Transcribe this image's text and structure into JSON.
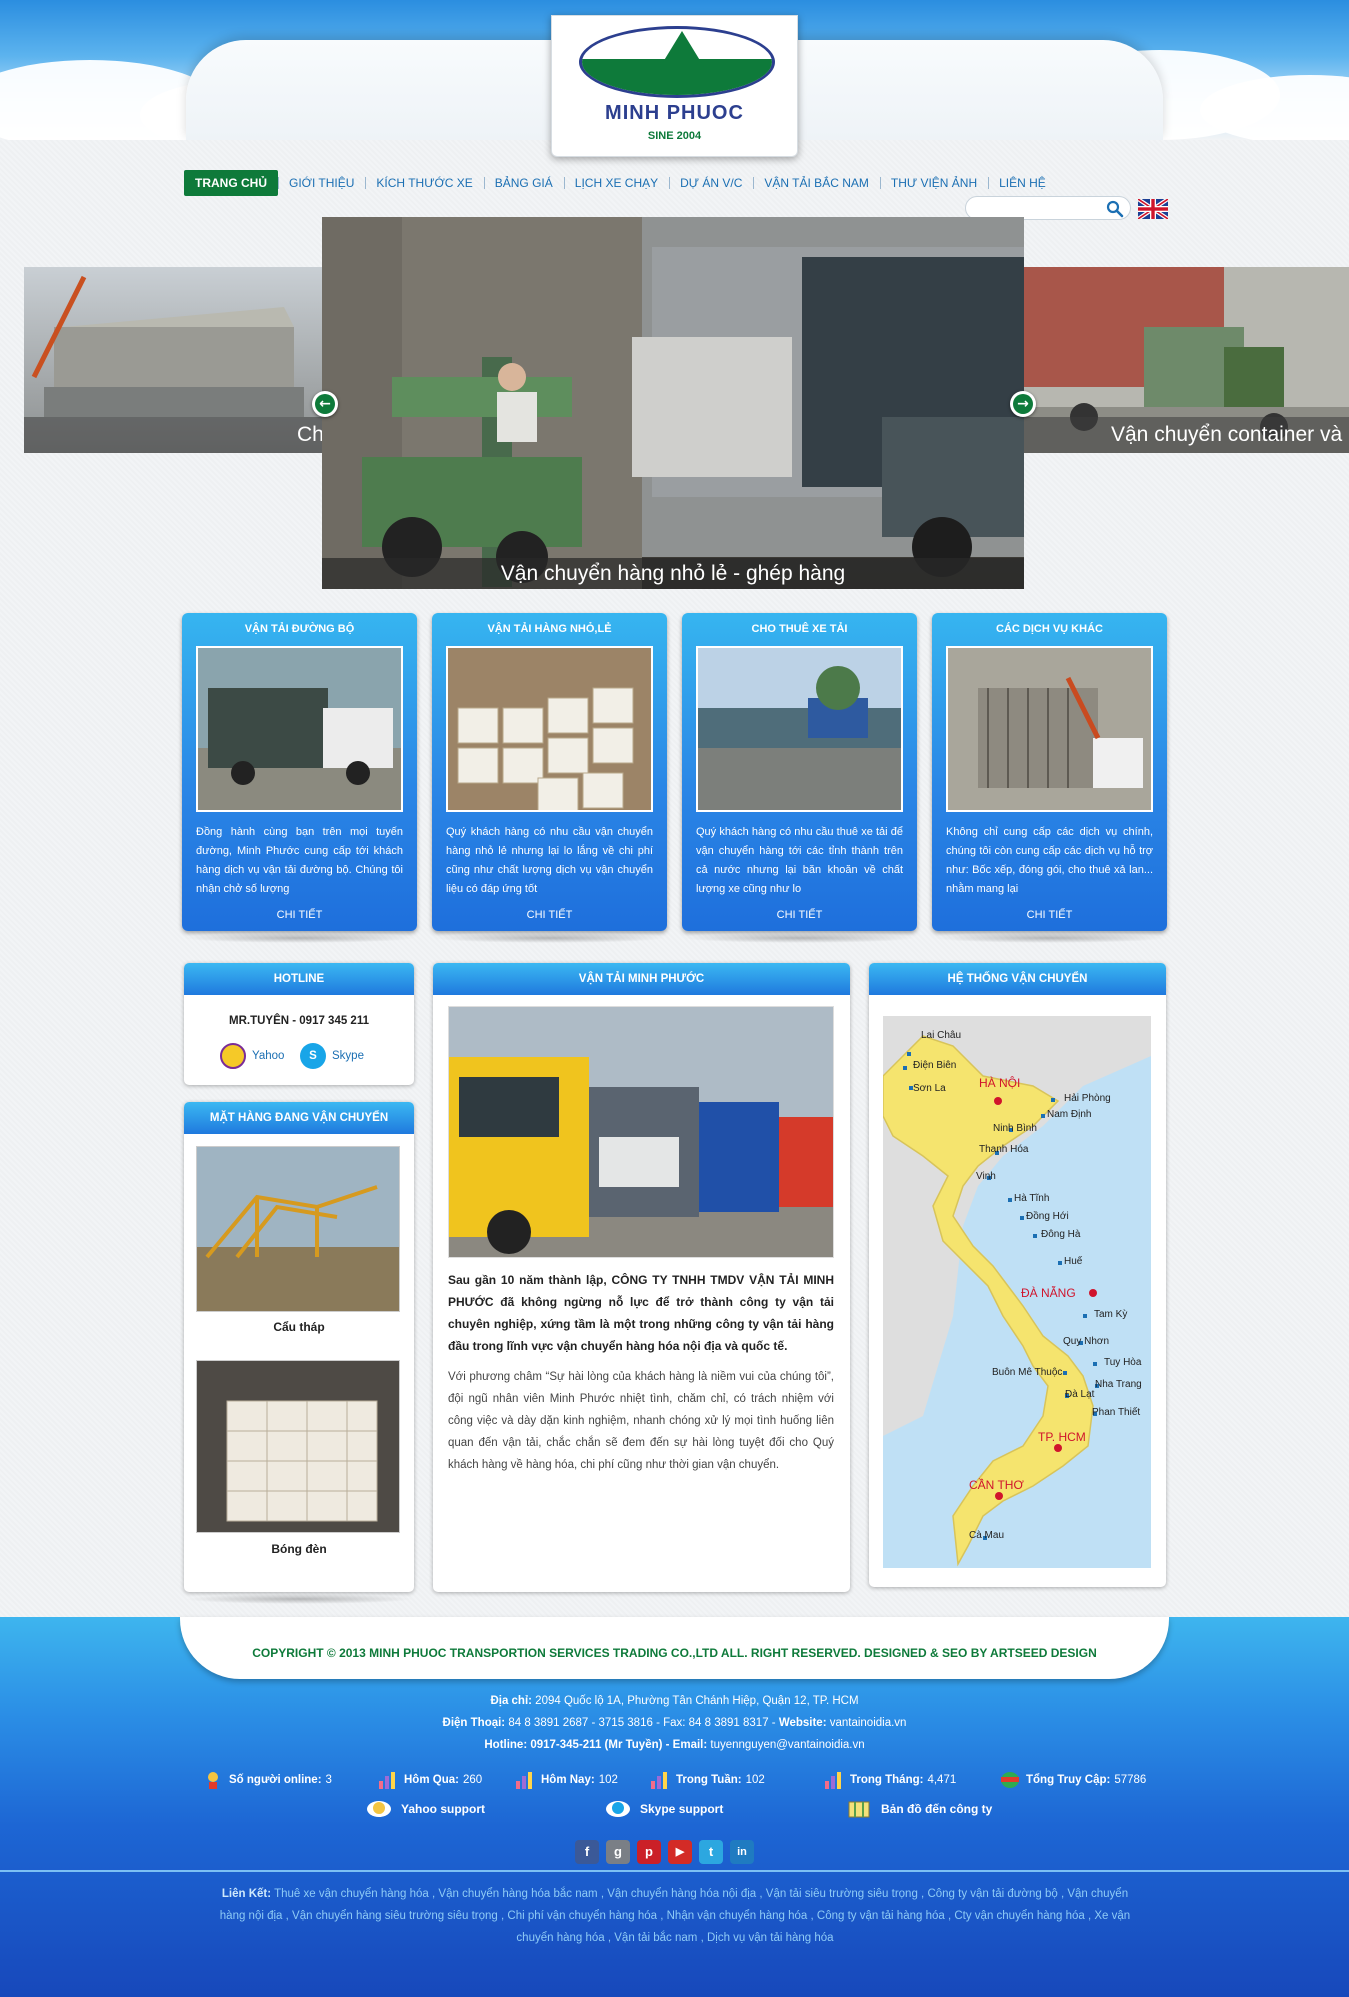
{
  "header": {
    "logo_name": "MINH PHUOC",
    "logo_since": "SINE 2004"
  },
  "nav": {
    "items": [
      {
        "label": "TRANG CHỦ",
        "active": true
      },
      {
        "label": "GIỚI THIỆU"
      },
      {
        "label": "KÍCH THƯỚC XE"
      },
      {
        "label": "BẢNG GIÁ"
      },
      {
        "label": "LỊCH XE CHẠY"
      },
      {
        "label": "DỰ ÁN V/C"
      },
      {
        "label": "VẬN TẢI BẮC NAM"
      },
      {
        "label": "THƯ VIỆN ẢNH"
      },
      {
        "label": "LIÊN HỆ"
      }
    ],
    "search_placeholder": "",
    "flag": "uk-flag-icon"
  },
  "slider": {
    "main_caption": "Vận chuyển hàng nhỏ lẻ - ghép hàng",
    "left_caption": "Ch",
    "right_caption": "Vận chuyển container và",
    "prev_icon": "arrow-left-icon",
    "next_icon": "arrow-right-icon"
  },
  "services": [
    {
      "title": "VẬN TẢI ĐƯỜNG BỘ",
      "text": "Đồng hành cùng bạn trên mọi tuyến đường, Minh Phước cung cấp tới khách hàng dịch vụ vận tải đường bộ. Chúng tôi nhận chở số lượng",
      "more": "CHI TIẾT"
    },
    {
      "title": "VẬN TẢI HÀNG NHỎ,LẺ",
      "text": "Quý khách hàng có nhu cầu vận chuyển hàng nhỏ lẻ nhưng lại lo lắng về chi phí cũng như chất lượng dịch vụ vận chuyển liệu có đáp ứng tốt",
      "more": "CHI TIẾT"
    },
    {
      "title": "CHO THUÊ XE TẢI",
      "text": "Quý khách hàng có nhu cầu thuê xe tải để vận chuyển hàng tới các tỉnh thành trên cả nước nhưng lại băn khoăn về chất lượng xe cũng như lo",
      "more": "CHI TIẾT"
    },
    {
      "title": "CÁC DỊCH VỤ KHÁC",
      "text": "Không chỉ cung cấp các dịch vụ chính, chúng tôi còn cung cấp các dịch vụ hỗ trợ như: Bốc xếp, đóng gói, cho thuê xả lan... nhằm mang lại",
      "more": "CHI TIẾT"
    }
  ],
  "hotline": {
    "title": "HOTLINE",
    "name": "MR.TUYÊN - 0917 345 211",
    "yahoo": "Yahoo",
    "skype": "Skype"
  },
  "goods": {
    "title": "MẶT HÀNG ĐANG VẬN CHUYỂN",
    "items": [
      {
        "caption": "Cẩu tháp"
      },
      {
        "caption": "Bóng đèn"
      }
    ]
  },
  "about": {
    "title": "VẬN TẢI MINH PHƯỚC",
    "bold_text": "Sau gần 10 năm thành lập, CÔNG TY TNHH TMDV VẬN TẢI MINH PHƯỚC đã không ngừng nỗ lực để trở thành công ty vận tải chuyên nghiệp, xứng tầm là một trong những công ty vận tải hàng đầu trong lĩnh vực vận chuyển hàng hóa nội địa và quốc tế.",
    "text": "Với phương châm “Sự hài lòng của khách hàng là niềm vui của chúng tôi”, đội ngũ nhân viên Minh Phước nhiệt tình, chăm chỉ, có trách nhiệm với công việc và dày dặn kinh nghiệm, nhanh chóng xử lý mọi tình huống liên quan đến vận tải, chắc chắn sẽ đem đến sự hài lòng tuyệt đối cho Quý khách hàng về hàng hóa, chi phí cũng như thời gian vận chuyển."
  },
  "system": {
    "title": "HỆ THỐNG VẬN CHUYỂN",
    "labels": {
      "lai_chau": "Lai Châu",
      "dien_bien": "Điện Biên",
      "son_la": "Sơn La",
      "ha_noi": "HÀ NỘI",
      "hai_phong": "Hải Phòng",
      "nam_dinh": "Nam Định",
      "ninh_binh": "Ninh Bình",
      "thanh_hoa": "Thanh Hóa",
      "vinh": "Vinh",
      "ha_tinh": "Hà Tĩnh",
      "dong_hoi": "Đồng Hới",
      "dong_ha": "Đông Hà",
      "hue": "Huế",
      "da_nang": "ĐÀ NẴNG",
      "tam_ky": "Tam Kỳ",
      "quy_nhon": "Quy Nhơn",
      "tuy_hoa": "Tuy Hòa",
      "buon_me_thuot": "Buôn Mê Thuộc",
      "nha_trang": "Nha Trang",
      "da_lat": "Đà Lạt",
      "phan_thiet": "Phan Thiết",
      "tp_hcm": "TP. HCM",
      "can_tho": "CẦN THƠ",
      "ca_mau": "Cà Mau"
    }
  },
  "footer": {
    "copyright": "COPYRIGHT © 2013 MINH PHUOC TRANSPORTION SERVICES TRADING CO.,LTD ALL. RIGHT RESERVED. DESIGNED & SEO BY ARTSEED DESIGN",
    "address_label": "Địa chỉ:",
    "address": " 2094 Quốc lộ 1A, Phường Tân Chánh Hiệp, Quận 12, TP. HCM",
    "phone_label": "Điện Thoại:",
    "phone": " 84 8 3891 2687 - 3715 3816 - Fax: 84 8 3891 8317 - ",
    "website_label": "Website:",
    "website": " vantainoidia.vn",
    "hotline_label": "Hotline: 0917-345-211 (Mr Tuyền) - Email:",
    "email": " tuyennguyen@vantainoidia.vn",
    "stats": [
      {
        "label": "Số người online:",
        "value": "3"
      },
      {
        "label": "Hôm Qua:",
        "value": "260"
      },
      {
        "label": "Hôm Nay:",
        "value": "102"
      },
      {
        "label": "Trong Tuần:",
        "value": "102"
      },
      {
        "label": "Trong Tháng:",
        "value": "4,471"
      },
      {
        "label": "Tổng Truy Cập:",
        "value": "57786"
      }
    ],
    "support": {
      "yahoo": "Yahoo support",
      "skype": "Skype support",
      "map": "Bản đồ đến công ty"
    },
    "social": [
      "f",
      "g",
      "p",
      "▶",
      "t",
      "in"
    ],
    "links_label": "Liên Kết:",
    "links": [
      "Thuê xe vận chuyển hàng hóa",
      "Vận chuyển hàng hóa bắc nam",
      "Vận chuyển hàng hóa nội địa",
      "Vận tải siêu trường siêu trọng",
      "Công ty vận tải đường bộ",
      "Vận chuyển hàng nội địa",
      "Vận chuyển hàng siêu trường siêu trọng",
      "Chi phí vận chuyển hàng hóa",
      "Nhận vận chuyển hàng hóa",
      "Công ty vận tải hàng hóa",
      "Cty vận chuyển hàng hóa",
      "Xe vận chuyển hàng hóa",
      "Vận tải bắc nam",
      "Dịch vụ vận tải hàng hóa"
    ]
  },
  "colors": {
    "brand_green": "#0e7a3a",
    "brand_blue": "#2c3f8f",
    "panel_blue": "#1f79de"
  }
}
